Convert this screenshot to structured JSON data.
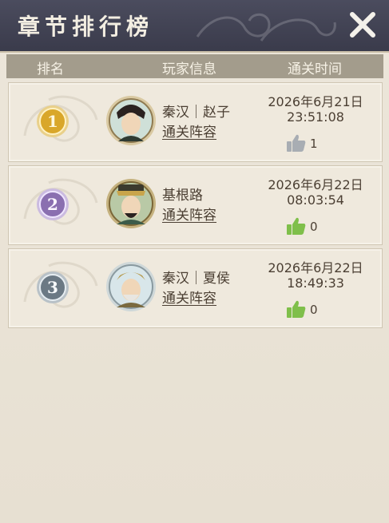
{
  "title": "章节排行榜",
  "header": {
    "rank": "排名",
    "player": "玩家信息",
    "time": "通关时间"
  },
  "rows": [
    {
      "rank": "1",
      "name": "秦汉｜赵子",
      "team_label": "通关阵容",
      "date": "2026年6月21日",
      "time": "23:51:08",
      "likes": "1",
      "liked": false
    },
    {
      "rank": "2",
      "name": "基根路",
      "team_label": "通关阵容",
      "date": "2026年6月22日",
      "time": "08:03:54",
      "likes": "0",
      "liked": true
    },
    {
      "rank": "3",
      "name": "秦汉｜夏侯",
      "team_label": "通关阵容",
      "date": "2026年6月22日",
      "time": "18:49:33",
      "likes": "0",
      "liked": true
    }
  ],
  "colors": {
    "gold": "#d9a72a",
    "purple": "#8a6fb0",
    "silver": "#6b7984",
    "like_active": "#7fbf4a",
    "like_inactive": "#a8adb3"
  },
  "icons": {
    "close": "close-icon",
    "like": "thumbs-up-icon"
  }
}
